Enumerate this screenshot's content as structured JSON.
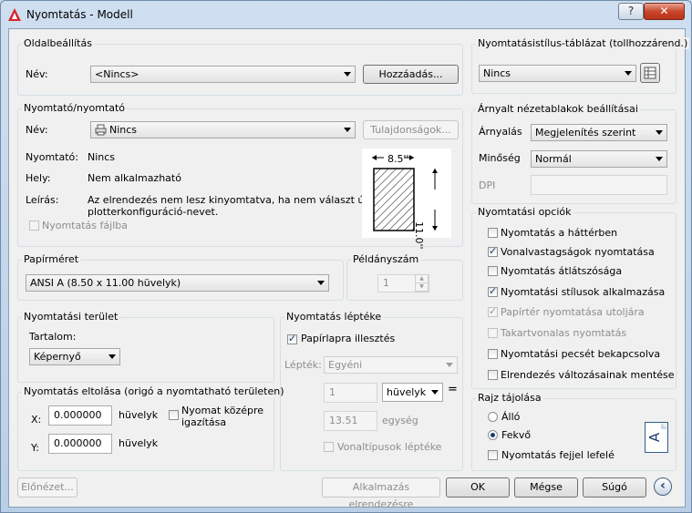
{
  "window": {
    "title": "Nyomtatás - Modell",
    "help_label": "?",
    "close_label": "✕"
  },
  "page_setup": {
    "title": "Oldalbeállítás",
    "name_label": "Név:",
    "name_value": "<Nincs>",
    "add_button": "Hozzáadás..."
  },
  "printer": {
    "title": "Nyomtató/nyomtató",
    "name_label": "Név:",
    "name_value": "Nincs",
    "properties_button": "Tulajdonságok...",
    "printer_label": "Nyomtató:",
    "printer_value": "Nincs",
    "location_label": "Hely:",
    "location_value": "Nem alkalmazható",
    "description_label": "Leírás:",
    "description_line1": "Az elrendezés nem lesz kinyomtatva, ha nem választ új",
    "description_line2": "plotterkonfiguráció-nevet.",
    "print_to_file": "Nyomtatás fájlba",
    "preview_width": "8.5''",
    "preview_height": "11.0''"
  },
  "paper_size": {
    "title": "Papírméret",
    "value": "ANSI A (8.50 x 11.00 hüvelyk)"
  },
  "copies": {
    "title": "Példányszám",
    "value": "1"
  },
  "plot_area": {
    "title": "Nyomtatási terület",
    "content_label": "Tartalom:",
    "value": "Képernyő"
  },
  "plot_offset": {
    "title": "Nyomtatás eltolása (origó a nyomtatható területen)",
    "x_label": "X:",
    "x_value": "0.000000",
    "x_unit": "hüvelyk",
    "y_label": "Y:",
    "y_value": "0.000000",
    "y_unit": "hüvelyk",
    "center_line1": "Nyomat középre",
    "center_line2": "igazítása"
  },
  "plot_scale": {
    "title": "Nyomtatás léptéke",
    "fit_label": "Papírlapra illesztés",
    "scale_label": "Lépték:",
    "scale_value": "Egyéni",
    "value1": "1",
    "unit1": "hüvelyk",
    "equals": "=",
    "value2": "13.51",
    "unit2": "egység",
    "lineweights": "Vonaltípusok léptéke"
  },
  "style_table": {
    "title": "Nyomtatásistílus-táblázat (tollhozzárend.)",
    "value": "Nincs"
  },
  "shaded": {
    "title": "Árnyalt nézetablakok beállításai",
    "shade_label": "Árnyalás",
    "shade_value": "Megjelenítés szerint",
    "quality_label": "Minőség",
    "quality_value": "Normál",
    "dpi_label": "DPI"
  },
  "options": {
    "title": "Nyomtatási opciók",
    "items": [
      {
        "label": "Nyomtatás a háttérben"
      },
      {
        "label": "Vonalvastagságok nyomtatása"
      },
      {
        "label": "Nyomtatás átlátszósága"
      },
      {
        "label": "Nyomtatási stílusok alkalmazása"
      },
      {
        "label": "Papírtér nyomtatása utoljára"
      },
      {
        "label": "Takartvonalas nyomtatás"
      },
      {
        "label": "Nyomtatási pecsét bekapcsolva"
      },
      {
        "label": "Elrendezés változásainak mentése"
      }
    ]
  },
  "orientation": {
    "title": "Rajz tájolása",
    "portrait": "Álló",
    "landscape": "Fekvő",
    "upside_down": "Nyomtatás fejjel lefelé",
    "icon_letter": "A"
  },
  "footer": {
    "preview": "Előnézet...",
    "apply": "Alkalmazás elrendezésre",
    "ok": "OK",
    "cancel": "Mégse",
    "help": "Súgó",
    "expand_glyph": "‹"
  },
  "colors": {
    "accent": "#1d3b6e",
    "close": "#c9462c",
    "autocad_red": "#d8262b"
  }
}
